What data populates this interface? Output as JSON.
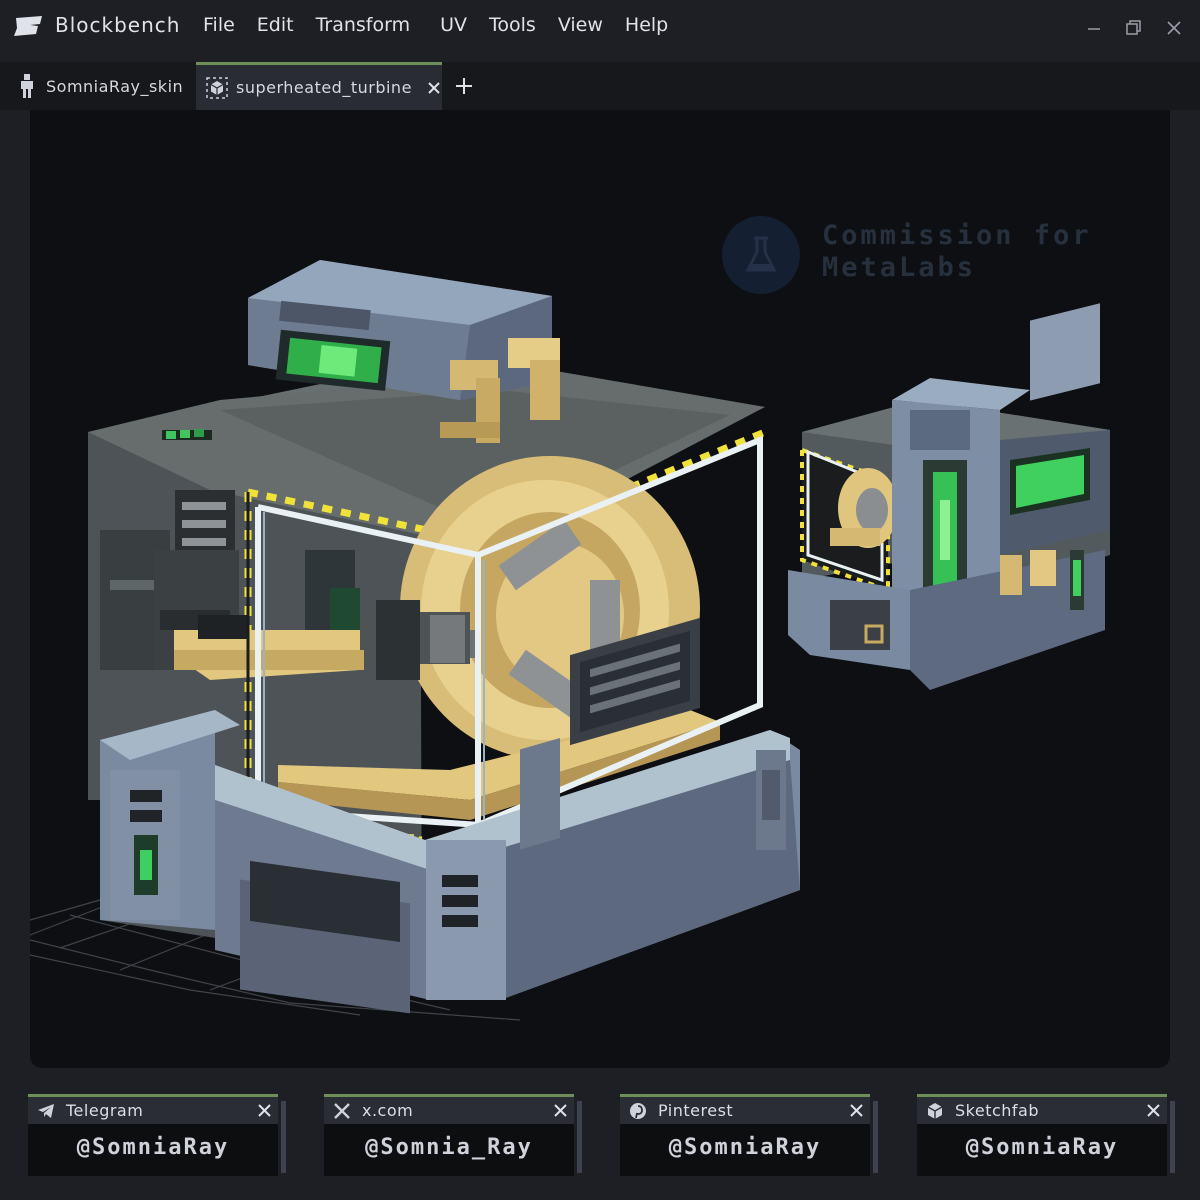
{
  "app": {
    "name": "Blockbench"
  },
  "menu": [
    "File",
    "Edit",
    "Transform",
    "UV",
    "Tools",
    "View",
    "Help"
  ],
  "tabs": [
    {
      "label": "SomniaRay_skin",
      "icon": "person-icon"
    },
    {
      "label": "superheated_turbine",
      "icon": "cube-icon",
      "active": true
    }
  ],
  "watermark": {
    "line1": "Commission for",
    "line2": "MetaLabs",
    "icon": "flask-icon"
  },
  "socials": [
    {
      "label": "Telegram",
      "handle": "@SomniaRay",
      "icon": "telegram-icon"
    },
    {
      "label": "x.com",
      "handle": "@Somnia_Ray",
      "icon": "x-icon"
    },
    {
      "label": "Pinterest",
      "handle": "@SomniaRay",
      "icon": "pinterest-icon"
    },
    {
      "label": "Sketchfab",
      "handle": "@SomniaRay",
      "icon": "sketchfab-icon"
    }
  ],
  "colors": {
    "accent": "#6f8f5a",
    "background": "#1e1f24",
    "viewport": "#0e0f12",
    "machine_steel": "#7f8fa5",
    "machine_dark": "#4a4f52",
    "brass": "#e3c884",
    "glow_green": "#49d66a",
    "hazard_yellow": "#f1e23a"
  }
}
